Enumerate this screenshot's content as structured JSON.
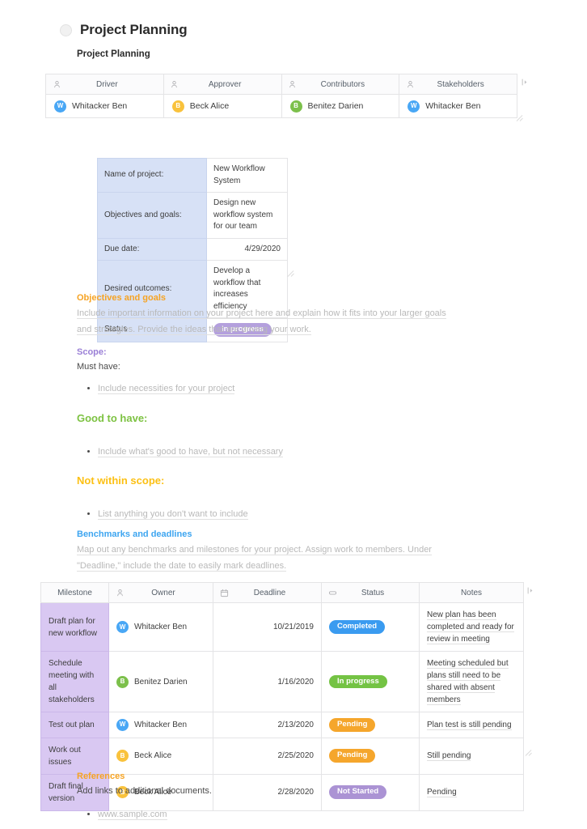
{
  "document": {
    "title": "Project Planning",
    "subtitle": "Project Planning",
    "bullet_icon": "circle-icon"
  },
  "roles_table": {
    "name": "roles-table",
    "columns": [
      {
        "label": "Driver",
        "icon": "person-icon"
      },
      {
        "label": "Approver",
        "icon": "person-icon"
      },
      {
        "label": "Contributors",
        "icon": "person-icon"
      },
      {
        "label": "Stakeholders",
        "icon": "person-icon"
      }
    ],
    "row": [
      {
        "name": "Whitacker Ben",
        "initial": "W",
        "color": "#49a7f5"
      },
      {
        "name": "Beck Alice",
        "initial": "B",
        "color": "#f9c23c"
      },
      {
        "name": "Benitez Darien",
        "initial": "B",
        "color": "#7cc04b"
      },
      {
        "name": "Whitacker Ben",
        "initial": "W",
        "color": "#49a7f5"
      }
    ],
    "add_column_icon": "add-column-icon",
    "resize_icon": "resize-grip-icon"
  },
  "details_table": {
    "rows": [
      {
        "label": "Name of project:",
        "value": "New Workflow System",
        "align": "left"
      },
      {
        "label": "Objectives and goals:",
        "value": "Design new workflow system for our team",
        "align": "left"
      },
      {
        "label": "Due date:",
        "value": "4/29/2020",
        "align": "right"
      },
      {
        "label": "Desired outcomes:",
        "value": "Develop a workflow that increases efficiency",
        "align": "left"
      },
      {
        "label": "Status",
        "value": "In progress",
        "align": "left",
        "badge": "lilac"
      }
    ],
    "resize_icon": "resize-grip-icon"
  },
  "sections": {
    "objectives": {
      "heading": "Objectives and goals",
      "body": "Include important information on your project here and explain how it fits into your larger goals and strategies. Provide the ideas that are driving your work."
    },
    "scope": {
      "heading": "Scope:",
      "subheading": "Must have:",
      "bullets": [
        "Include necessities for your project"
      ]
    },
    "good_to_have": {
      "heading": "Good to have:",
      "bullets": [
        "Include what's good to have, but not necessary"
      ]
    },
    "not_within_scope": {
      "heading": "Not within scope:",
      "bullets": [
        "List anything you don't want to include"
      ]
    },
    "benchmarks": {
      "heading": "Benchmarks and deadlines",
      "body": "Map out any benchmarks and milestones for your project. Assign work to members. Under \"Deadline,\" include the date to easily mark deadlines."
    },
    "references": {
      "heading": "References",
      "body": "Add links to additional documents.",
      "bullets": [
        "www.sample.com"
      ]
    }
  },
  "milestones_table": {
    "columns": [
      {
        "label": "Milestone",
        "icon": null
      },
      {
        "label": "Owner",
        "icon": "person-icon"
      },
      {
        "label": "Deadline",
        "icon": "calendar-icon"
      },
      {
        "label": "Status",
        "icon": "tag-icon"
      },
      {
        "label": "Notes",
        "icon": null
      }
    ],
    "rows": [
      {
        "milestone": "Draft plan for new workflow",
        "owner": {
          "name": "Whitacker Ben",
          "initial": "W",
          "color": "#49a7f5"
        },
        "deadline": "10/21/2019",
        "status": {
          "label": "Completed",
          "style": "blue"
        },
        "notes": "New plan has been completed and ready for review in meeting"
      },
      {
        "milestone": "Schedule meeting with all stakeholders",
        "owner": {
          "name": "Benitez Darien",
          "initial": "B",
          "color": "#7cc04b"
        },
        "deadline": "1/16/2020",
        "status": {
          "label": "In progress",
          "style": "green"
        },
        "notes": "Meeting scheduled but plans still need to be shared with absent members"
      },
      {
        "milestone": "Test out plan",
        "owner": {
          "name": "Whitacker Ben",
          "initial": "W",
          "color": "#49a7f5"
        },
        "deadline": "2/13/2020",
        "status": {
          "label": "Pending",
          "style": "orange"
        },
        "notes": "Plan test is still pending"
      },
      {
        "milestone": "Work out issues",
        "owner": {
          "name": "Beck Alice",
          "initial": "B",
          "color": "#f9c23c"
        },
        "deadline": "2/25/2020",
        "status": {
          "label": "Pending",
          "style": "orange"
        },
        "notes": "Still pending"
      },
      {
        "milestone": "Draft final version",
        "owner": {
          "name": "Beck Alice",
          "initial": "B",
          "color": "#f9c23c"
        },
        "deadline": "2/28/2020",
        "status": {
          "label": "Not Started",
          "style": "purple"
        },
        "notes": "Pending"
      }
    ],
    "add_column_icon": "add-column-icon",
    "resize_icon": "resize-grip-icon"
  },
  "colors": {
    "accent_orange": "#f6a323",
    "accent_purple": "#9a7fd6",
    "accent_green": "#7dc242",
    "accent_yellow": "#fcc014",
    "accent_blue": "#3da5f0",
    "milestone_column_bg": "#d9c8f2",
    "label_column_bg": "#d7e1f6"
  }
}
